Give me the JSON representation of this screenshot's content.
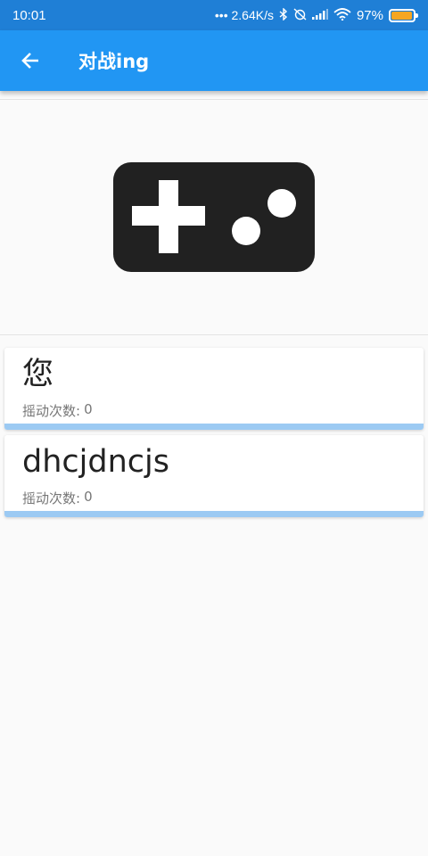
{
  "status_bar": {
    "time": "10:01",
    "network_speed": "••• 2.64K/s",
    "battery_percent": "97%",
    "battery_level": 0.97,
    "icons": [
      "bluetooth-icon",
      "alarm-off-icon",
      "signal-icon",
      "wifi-icon",
      "battery-icon"
    ]
  },
  "app_bar": {
    "title": "对战ing",
    "back_icon": "arrow-back-icon"
  },
  "hero": {
    "icon": "gamepad-icon"
  },
  "players": [
    {
      "name": "您",
      "shake_label": "摇动次数:",
      "shake_count": "0",
      "progress": 0
    },
    {
      "name": "dhcjdncjs",
      "shake_label": "摇动次数:",
      "shake_count": "0",
      "progress": 0
    }
  ],
  "colors": {
    "primary": "#2196f3",
    "status_bar": "#1f7fd6",
    "progress_track": "#9ccaf3",
    "background": "#fafafa"
  }
}
